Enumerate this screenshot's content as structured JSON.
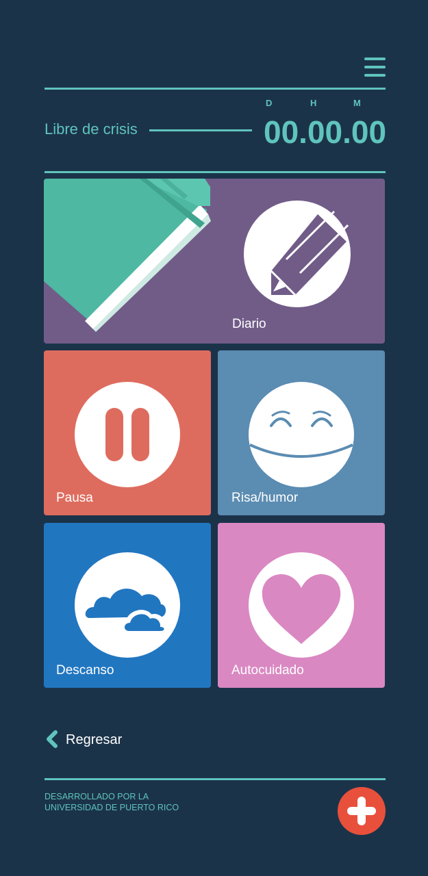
{
  "header": {
    "menu_icon": "hamburger-menu-icon",
    "crisis_label": "Libre de crisis",
    "timer": {
      "units": [
        "D",
        "H",
        "M"
      ],
      "value": "00.00.00"
    }
  },
  "tiles": [
    {
      "id": "diario",
      "label": "Diario",
      "color": "#715c88",
      "icon": "pencil-icon"
    },
    {
      "id": "pausa",
      "label": "Pausa",
      "color": "#de6c5e",
      "icon": "pause-icon"
    },
    {
      "id": "risa",
      "label": "Risa/humor",
      "color": "#5b8cb2",
      "icon": "smiley-face-icon"
    },
    {
      "id": "descanso",
      "label": "Descanso",
      "color": "#2176c0",
      "icon": "clouds-icon"
    },
    {
      "id": "autocuidado",
      "label": "Autocuidado",
      "color": "#da88c2",
      "icon": "heart-icon"
    }
  ],
  "navigation": {
    "back_label": "Regresar",
    "back_icon": "chevron-left-icon"
  },
  "footer": {
    "line1": "DESARROLLADO POR LA",
    "line2": "UNIVERSIDAD DE PUERTO RICO",
    "sos_icon": "plus-icon",
    "sos_color": "#e8503c"
  },
  "colors": {
    "background": "#1b3349",
    "accent": "#5fc4bd"
  }
}
